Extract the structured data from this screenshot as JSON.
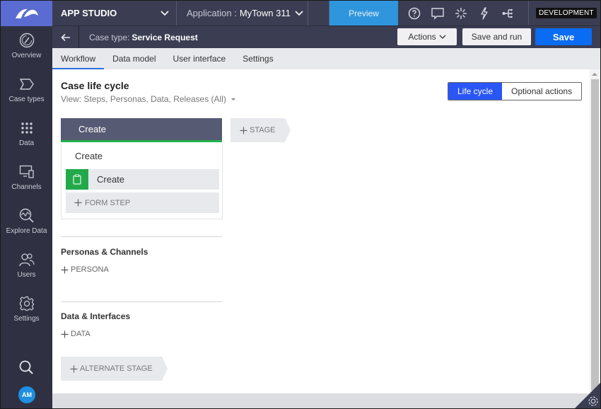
{
  "topbar": {
    "studio_label": "APP STUDIO",
    "application_label": "Application :",
    "application_value": "MyTown 311",
    "preview_label": "Preview",
    "icons": [
      "help-icon",
      "chat-icon",
      "sparkle-icon",
      "lightning-icon",
      "hierarchy-icon"
    ],
    "environment_badge": "DEVELOPMENT",
    "colors": {
      "logo_bg": "#5a6bd1",
      "bar_bg": "#3b3d52",
      "preview_bg": "#2f96dd"
    }
  },
  "subbar": {
    "case_type_label": "Case type:",
    "case_type_value": "Service Request",
    "actions_label": "Actions",
    "save_and_run_label": "Save and run",
    "save_label": "Save",
    "save_color": "#0a6cf2"
  },
  "leftnav": {
    "items": [
      {
        "label": "Overview",
        "icon": "gauge-icon"
      },
      {
        "label": "Case types",
        "icon": "case-types-icon"
      },
      {
        "label": "Data",
        "icon": "grid-dots-icon"
      },
      {
        "label": "Channels",
        "icon": "devices-icon"
      },
      {
        "label": "Explore Data",
        "icon": "explore-data-icon"
      },
      {
        "label": "Users",
        "icon": "users-icon"
      },
      {
        "label": "Settings",
        "icon": "gear-icon"
      }
    ],
    "search_icon": "search-icon",
    "avatar_initials": "AM"
  },
  "tabs": [
    {
      "label": "Workflow",
      "active": true
    },
    {
      "label": "Data model",
      "active": false
    },
    {
      "label": "User interface",
      "active": false
    },
    {
      "label": "Settings",
      "active": false
    }
  ],
  "main": {
    "title": "Case life cycle",
    "view_filter": "View: Steps, Personas, Data, Releases (All)",
    "toggle": {
      "options": [
        "Life cycle",
        "Optional actions"
      ],
      "selected": "Life cycle"
    },
    "stage": {
      "name": "Create",
      "process_name": "Create",
      "steps": [
        {
          "label": "Create",
          "icon": "clipboard-icon"
        }
      ],
      "add_step_label": "FORM STEP"
    },
    "add_stage_label": "STAGE",
    "personas_section": {
      "heading": "Personas & Channels",
      "add_label": "PERSONA"
    },
    "data_section": {
      "heading": "Data & Interfaces",
      "add_label": "DATA"
    },
    "alternate_stage_label": "ALTERNATE STAGE"
  }
}
